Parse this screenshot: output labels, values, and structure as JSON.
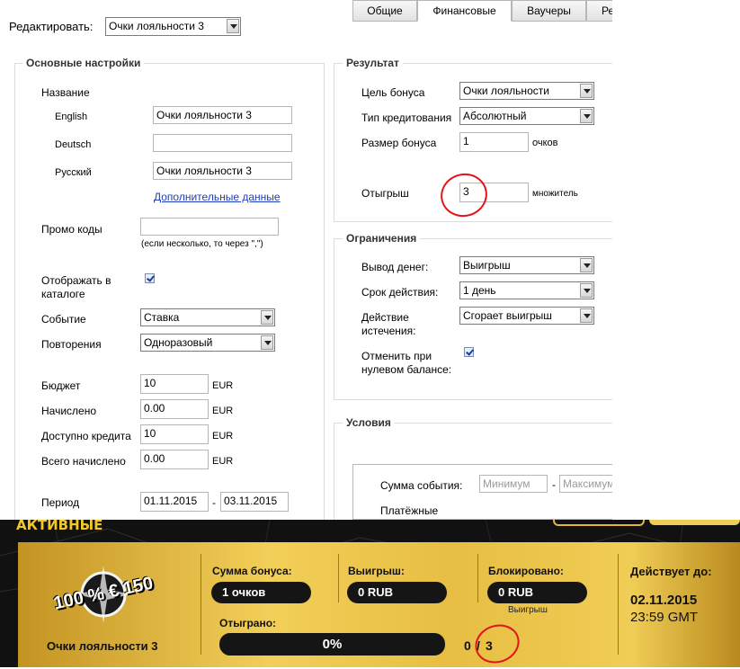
{
  "top": {
    "edit_label": "Редактировать:",
    "edit_value": "Очки лояльности 3"
  },
  "main": {
    "legend": "Основные настройки",
    "name_label": "Название",
    "langs": [
      {
        "label": "English",
        "value": "Очки лояльности 3"
      },
      {
        "label": "Deutsch",
        "value": ""
      },
      {
        "label": "Русский",
        "value": "Очки лояльности 3"
      }
    ],
    "extra_link": "Дополнительные данные",
    "promo_label": "Промо коды",
    "promo_hint": "(если несколько, то через \",\")",
    "catalog_label_1": "Отображать в",
    "catalog_label_2": "каталоге",
    "event_label": "Событие",
    "event_value": "Ставка",
    "repeat_label": "Повторения",
    "repeat_value": "Одноразовый",
    "money": [
      {
        "label": "Бюджет",
        "value": "10",
        "unit": "EUR"
      },
      {
        "label": "Начислено",
        "value": "0.00",
        "unit": "EUR"
      },
      {
        "label": "Доступно кредита",
        "value": "10",
        "unit": "EUR"
      },
      {
        "label": "Всего начислено",
        "value": "0.00",
        "unit": "EUR"
      }
    ],
    "period_label": "Период",
    "period_from": "01.11.2015",
    "period_dash": "-",
    "period_to": "03.11.2015"
  },
  "result": {
    "legend": "Результат",
    "goal_label": "Цель бонуса",
    "goal_value": "Очки лояльности",
    "credit_label": "Тип кредитования",
    "credit_value": "Абсолютный",
    "size_label": "Размер бонуса",
    "size_value": "1",
    "size_unit": "очков",
    "wager_label": "Отыгрыш",
    "wager_value": "3",
    "wager_unit": "множитель"
  },
  "limits": {
    "legend": "Ограничения",
    "withdraw_label": "Вывод денег:",
    "withdraw_value": "Выигрыш",
    "term_label": "Срок действия:",
    "term_value": "1 день",
    "expiry_label_1": "Действие",
    "expiry_label_2": "истечения:",
    "expiry_value": "Сгорает выигрыш",
    "cancel_label_1": "Отменить при",
    "cancel_label_2": "нулевом балансе:"
  },
  "conditions": {
    "legend": "Условия",
    "tabs": [
      "Общие",
      "Финансовые",
      "Ваучеры",
      "Ре"
    ],
    "sum_label": "Сумма события:",
    "min_placeholder": "Минимум",
    "dash": "-",
    "max_placeholder": "Максимум",
    "payment_label": "Платёжные"
  },
  "banner": {
    "active_title": "АКТИВНЫЕ",
    "logo_text": "100 % € 150",
    "bonus_name": "Очки лояльности 3",
    "bonus_sum_label": "Сумма бонуса:",
    "bonus_sum_value": "1 очков",
    "win_label": "Выигрыш:",
    "win_value": "0 RUB",
    "blocked_label": "Блокировано:",
    "blocked_value": "0 RUB",
    "blocked_note": "Выигрыш",
    "valid_label": "Действует до:",
    "valid_date": "02.11.2015",
    "valid_time": "23:59 GMT",
    "wagered_label": "Отыграно:",
    "progress_text": "0%",
    "progress_fraction": 0,
    "counter_done": "0",
    "counter_slash": "/",
    "counter_total": "3"
  },
  "colors": {
    "annotation_red": "#e0151b",
    "gold": "#e7be43",
    "link": "#1a3fbf"
  }
}
